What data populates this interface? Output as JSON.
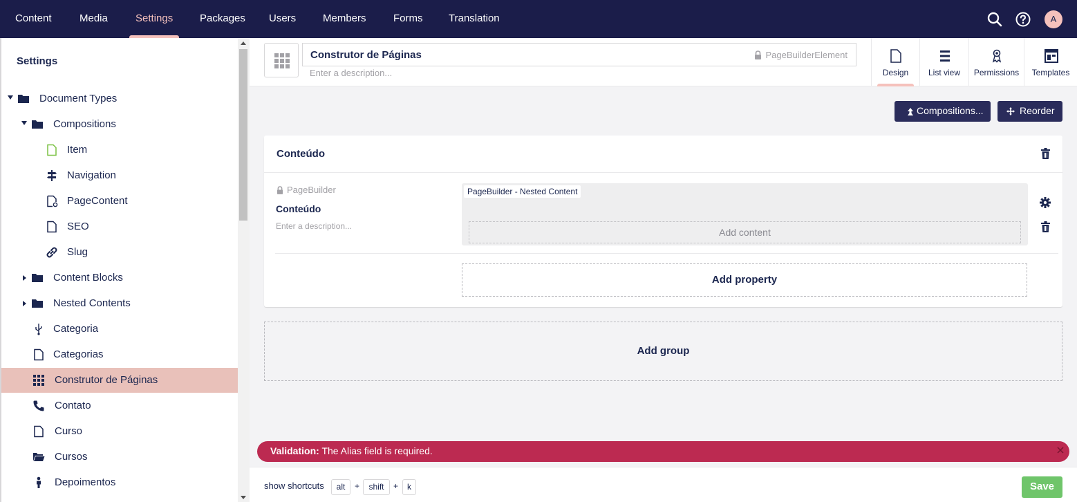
{
  "topnav": {
    "items": [
      {
        "label": "Content"
      },
      {
        "label": "Media"
      },
      {
        "label": "Settings"
      },
      {
        "label": "Packages"
      },
      {
        "label": "Users"
      },
      {
        "label": "Members"
      },
      {
        "label": "Forms"
      },
      {
        "label": "Translation"
      }
    ],
    "active": "Settings",
    "avatar_initial": "A",
    "bg_color": "#1b1d4a",
    "active_color": "#f5c1bc"
  },
  "sidebar": {
    "title": "Settings",
    "tree": [
      {
        "label": "Document Types",
        "icon": "folder-icon",
        "expanded": true
      },
      {
        "label": "Compositions",
        "icon": "folder-icon",
        "expanded": true
      },
      {
        "label": "Item",
        "icon": "document-icon"
      },
      {
        "label": "Navigation",
        "icon": "signpost-icon"
      },
      {
        "label": "PageContent",
        "icon": "document-settings-icon"
      },
      {
        "label": "SEO",
        "icon": "document-icon"
      },
      {
        "label": "Slug",
        "icon": "link-icon"
      },
      {
        "label": "Content Blocks",
        "icon": "folder-icon",
        "expanded": false
      },
      {
        "label": "Nested Contents",
        "icon": "folder-icon",
        "expanded": false
      },
      {
        "label": "Categoria",
        "icon": "usb-icon"
      },
      {
        "label": "Categorias",
        "icon": "document-icon"
      },
      {
        "label": "Construtor de Páginas",
        "icon": "grid-icon",
        "selected": true
      },
      {
        "label": "Contato",
        "icon": "phone-icon"
      },
      {
        "label": "Curso",
        "icon": "document-icon"
      },
      {
        "label": "Cursos",
        "icon": "folder-open-icon"
      },
      {
        "label": "Depoimentos",
        "icon": "person-icon"
      }
    ],
    "selected_color": "#e9c1ba"
  },
  "header": {
    "name": "Construtor de Páginas",
    "alias": "PageBuilderElement",
    "description_placeholder": "Enter a description...",
    "tabs": [
      {
        "label": "Design",
        "active": true
      },
      {
        "label": "List view"
      },
      {
        "label": "Permissions"
      },
      {
        "label": "Templates"
      }
    ]
  },
  "toolbar": {
    "compositions_label": "Compositions...",
    "reorder_label": "Reorder"
  },
  "group": {
    "title": "Conteúdo",
    "property": {
      "alias": "PageBuilder",
      "name": "Conteúdo",
      "description_placeholder": "Enter a description...",
      "editor_tag": "PageBuilder - Nested Content",
      "add_content_label": "Add content"
    },
    "add_property_label": "Add property"
  },
  "add_group_label": "Add group",
  "validation": {
    "prefix": "Validation:",
    "message": "The Alias field is required.",
    "color": "#bc2a51"
  },
  "footer": {
    "shortcuts_label": "show shortcuts",
    "keys": [
      "alt",
      "shift",
      "k"
    ],
    "plus": "+",
    "save_label": "Save",
    "save_color": "#6fc56a"
  }
}
